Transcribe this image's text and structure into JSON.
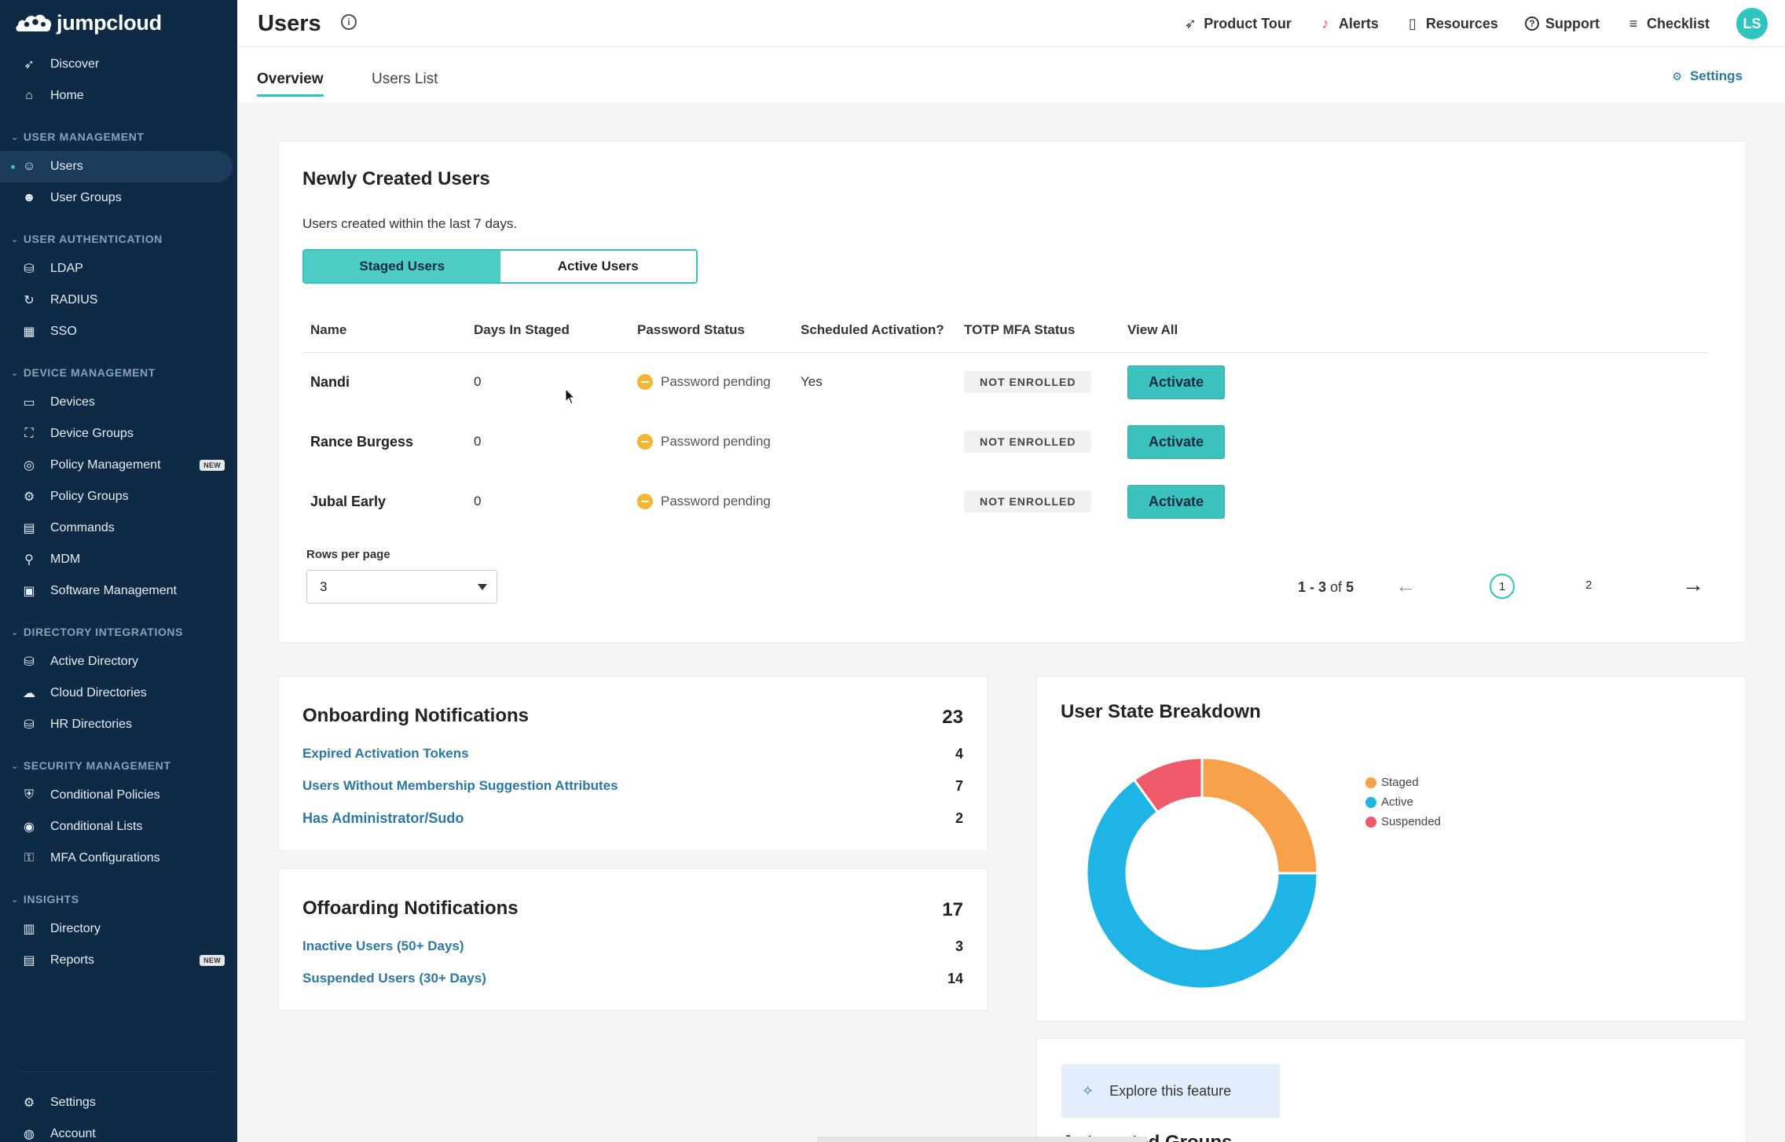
{
  "sidebar": {
    "brand": "jumpcloud",
    "top_items": [
      {
        "label": "Discover",
        "icon": "rocket-icon"
      },
      {
        "label": "Home",
        "icon": "home-icon"
      }
    ],
    "sections": [
      {
        "title": "USER MANAGEMENT",
        "items": [
          {
            "label": "Users",
            "icon": "user-icon",
            "active": true
          },
          {
            "label": "User Groups",
            "icon": "user-groups-icon"
          }
        ]
      },
      {
        "title": "USER AUTHENTICATION",
        "items": [
          {
            "label": "LDAP",
            "icon": "ldap-icon"
          },
          {
            "label": "RADIUS",
            "icon": "radius-icon"
          },
          {
            "label": "SSO",
            "icon": "sso-icon"
          }
        ]
      },
      {
        "title": "DEVICE MANAGEMENT",
        "items": [
          {
            "label": "Devices",
            "icon": "devices-icon"
          },
          {
            "label": "Device Groups",
            "icon": "device-groups-icon"
          },
          {
            "label": "Policy Management",
            "icon": "policy-icon",
            "badge": "NEW"
          },
          {
            "label": "Policy Groups",
            "icon": "policy-groups-icon"
          },
          {
            "label": "Commands",
            "icon": "commands-icon"
          },
          {
            "label": "MDM",
            "icon": "mdm-icon"
          },
          {
            "label": "Software Management",
            "icon": "software-icon"
          }
        ]
      },
      {
        "title": "DIRECTORY INTEGRATIONS",
        "items": [
          {
            "label": "Active Directory",
            "icon": "active-directory-icon"
          },
          {
            "label": "Cloud Directories",
            "icon": "cloud-directories-icon"
          },
          {
            "label": "HR Directories",
            "icon": "hr-directories-icon"
          }
        ]
      },
      {
        "title": "SECURITY MANAGEMENT",
        "items": [
          {
            "label": "Conditional Policies",
            "icon": "shield-icon"
          },
          {
            "label": "Conditional Lists",
            "icon": "list-icon"
          },
          {
            "label": "MFA Configurations",
            "icon": "mfa-icon"
          }
        ]
      },
      {
        "title": "INSIGHTS",
        "items": [
          {
            "label": "Directory",
            "icon": "chart-icon"
          },
          {
            "label": "Reports",
            "icon": "report-icon",
            "badge": "NEW"
          }
        ]
      }
    ],
    "bottom_items": [
      {
        "label": "Settings",
        "icon": "gear-icon"
      },
      {
        "label": "Account",
        "icon": "account-icon"
      }
    ]
  },
  "header": {
    "title": "Users",
    "links": [
      {
        "label": "Product Tour",
        "icon": "rocket-icon"
      },
      {
        "label": "Alerts",
        "icon": "bell-icon"
      },
      {
        "label": "Resources",
        "icon": "book-icon"
      },
      {
        "label": "Support",
        "icon": "help-icon"
      },
      {
        "label": "Checklist",
        "icon": "checklist-icon"
      }
    ],
    "avatar_initials": "LS"
  },
  "tabs": [
    {
      "label": "Overview",
      "active": true
    },
    {
      "label": "Users List",
      "active": false
    }
  ],
  "settings_label": "Settings",
  "newly_created": {
    "title": "Newly Created Users",
    "subtitle": "Users created within the last 7 days.",
    "segments": [
      "Staged Users",
      "Active Users"
    ],
    "columns": [
      "Name",
      "Days In Staged",
      "Password Status",
      "Scheduled Activation?",
      "TOTP MFA Status",
      "View All"
    ],
    "rows": [
      {
        "name": "Nandi",
        "days": "0",
        "password": "Password pending",
        "scheduled": "Yes",
        "mfa": "NOT ENROLLED",
        "action": "Activate"
      },
      {
        "name": "Rance Burgess",
        "days": "0",
        "password": "Password pending",
        "scheduled": "",
        "mfa": "NOT ENROLLED",
        "action": "Activate"
      },
      {
        "name": "Jubal Early",
        "days": "0",
        "password": "Password pending",
        "scheduled": "",
        "mfa": "NOT ENROLLED",
        "action": "Activate"
      }
    ],
    "rows_per_page_label": "Rows per page",
    "rows_per_page": "3",
    "pagination": {
      "range": "1 - 3",
      "of_label": "of",
      "total": "5",
      "page1": "1",
      "page2": "2"
    }
  },
  "onboarding": {
    "title": "Onboarding Notifications",
    "total": "23",
    "items": [
      {
        "label": "Expired Activation Tokens",
        "count": "4"
      },
      {
        "label": "Users Without Membership Suggestion Attributes",
        "count": "7"
      },
      {
        "label": "Has Administrator/Sudo",
        "count": "2"
      }
    ]
  },
  "offboarding": {
    "title": "Offoarding Notifications",
    "total": "17",
    "items": [
      {
        "label": "Inactive Users (50+ Days)",
        "count": "3"
      },
      {
        "label": "Suspended Users (30+ Days)",
        "count": "14"
      }
    ]
  },
  "user_state": {
    "title": "User State Breakdown",
    "legend": [
      {
        "label": "Staged",
        "color": "#f7a14a"
      },
      {
        "label": "Active",
        "color": "#1eb5e6"
      },
      {
        "label": "Suspended",
        "color": "#ee5a6a"
      }
    ]
  },
  "chart_data": {
    "type": "pie",
    "title": "User State Breakdown",
    "categories": [
      "Staged",
      "Active",
      "Suspended"
    ],
    "values": [
      25,
      65,
      10
    ],
    "colors": [
      "#f7a14a",
      "#1eb5e6",
      "#ee5a6a"
    ],
    "legend": "right"
  },
  "explore": {
    "button": "Explore this feature",
    "next_title": "Automated Groups"
  }
}
